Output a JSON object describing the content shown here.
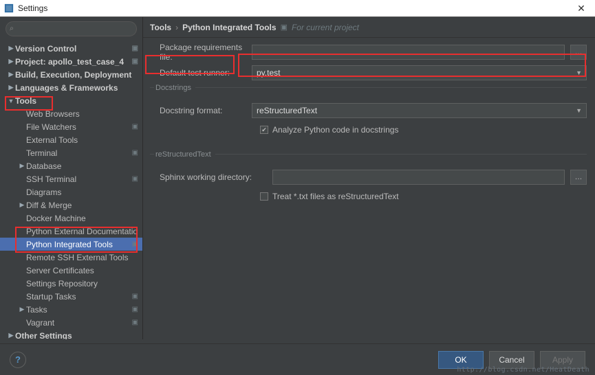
{
  "window": {
    "title": "Settings"
  },
  "search": {
    "placeholder": ""
  },
  "sidebar": {
    "items": [
      {
        "label": "Version Control",
        "bold": true,
        "arrow": "right",
        "depth": 0,
        "proj": true
      },
      {
        "label": "Project: apollo_test_case_4",
        "bold": true,
        "arrow": "right",
        "depth": 0,
        "proj": true
      },
      {
        "label": "Build, Execution, Deployment",
        "bold": true,
        "arrow": "right",
        "depth": 0
      },
      {
        "label": "Languages & Frameworks",
        "bold": true,
        "arrow": "right",
        "depth": 0
      },
      {
        "label": "Tools",
        "bold": true,
        "arrow": "down",
        "depth": 0
      },
      {
        "label": "Web Browsers",
        "depth": 1
      },
      {
        "label": "File Watchers",
        "depth": 1,
        "proj": true
      },
      {
        "label": "External Tools",
        "depth": 1
      },
      {
        "label": "Terminal",
        "depth": 1,
        "proj": true
      },
      {
        "label": "Database",
        "arrow": "right",
        "depth": 1
      },
      {
        "label": "SSH Terminal",
        "depth": 1,
        "proj": true
      },
      {
        "label": "Diagrams",
        "depth": 1
      },
      {
        "label": "Diff & Merge",
        "arrow": "right",
        "depth": 1
      },
      {
        "label": "Docker Machine",
        "depth": 1
      },
      {
        "label": "Python External Documentation",
        "depth": 1
      },
      {
        "label": "Python Integrated Tools",
        "depth": 1,
        "selected": true,
        "proj": true
      },
      {
        "label": "Remote SSH External Tools",
        "depth": 1
      },
      {
        "label": "Server Certificates",
        "depth": 1
      },
      {
        "label": "Settings Repository",
        "depth": 1
      },
      {
        "label": "Startup Tasks",
        "depth": 1,
        "proj": true
      },
      {
        "label": "Tasks",
        "arrow": "right",
        "depth": 1,
        "proj": true
      },
      {
        "label": "Vagrant",
        "depth": 1,
        "proj": true
      },
      {
        "label": "Other Settings",
        "bold": true,
        "arrow": "right",
        "depth": 0
      }
    ]
  },
  "breadcrumb": {
    "root": "Tools",
    "leaf": "Python Integrated Tools",
    "meta": "For current project"
  },
  "form": {
    "pkg_req_label": "Package requirements file:",
    "pkg_req_value": "",
    "test_runner_label": "Default test runner:",
    "test_runner_value": "py.test",
    "docstrings_section": "Docstrings",
    "docstring_fmt_label": "Docstring format:",
    "docstring_fmt_value": "reStructuredText",
    "analyze_cb_label": "Analyze Python code in docstrings",
    "analyze_cb_checked": true,
    "rst_section": "reStructuredText",
    "sphinx_dir_label": "Sphinx working directory:",
    "sphinx_dir_value": "",
    "treat_txt_label": "Treat *.txt files as reStructuredText",
    "treat_txt_checked": false
  },
  "footer": {
    "ok": "OK",
    "cancel": "Cancel",
    "apply": "Apply"
  },
  "watermark": "http://blog.csdn.net/HeatDeath"
}
